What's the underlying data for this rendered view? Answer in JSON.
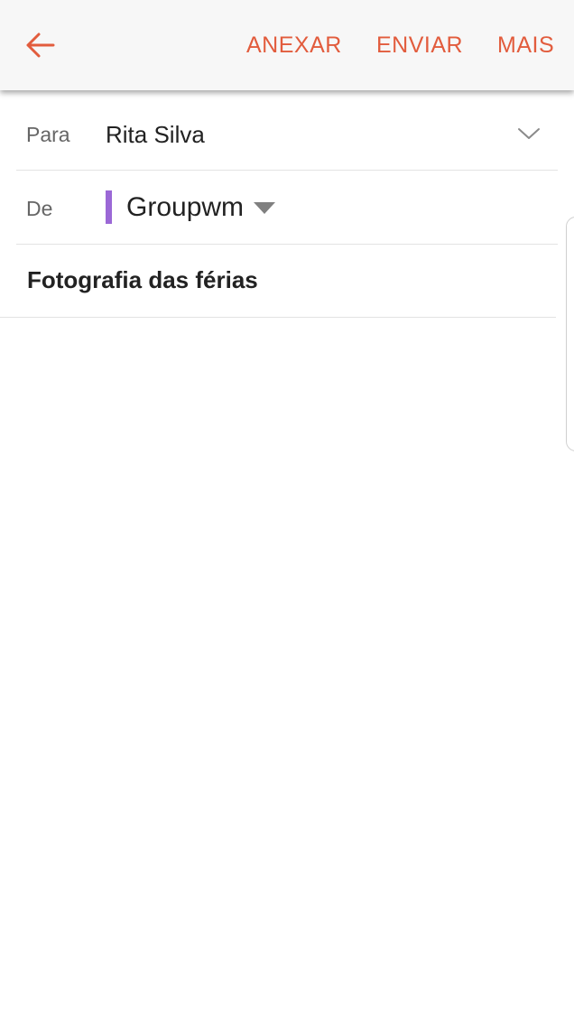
{
  "toolbar": {
    "back_icon": "arrow-left-icon",
    "actions": {
      "attach": "ANEXAR",
      "send": "ENVIAR",
      "more": "MAIS"
    }
  },
  "compose": {
    "to_label": "Para",
    "to_value": "Rita Silva",
    "from_label": "De",
    "from_value": "Groupwm",
    "subject": "Fotografia das férias",
    "body": ""
  },
  "colors": {
    "accent": "#e25c3d",
    "account_color": "#9b68d6"
  }
}
